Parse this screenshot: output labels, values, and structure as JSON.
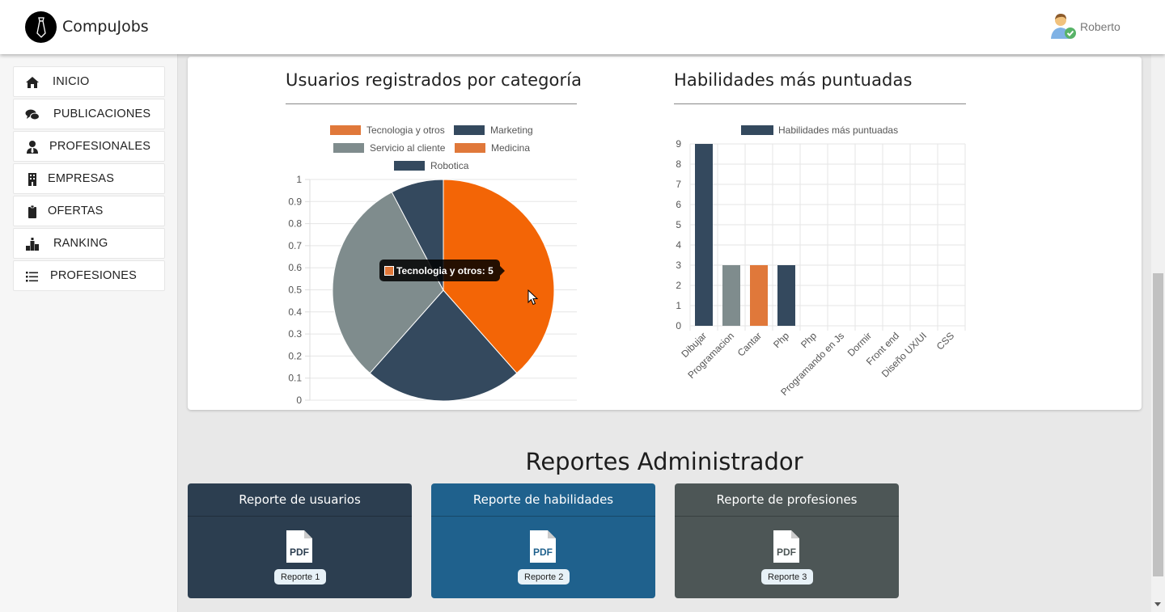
{
  "app": {
    "name": "CompuJobs",
    "user": "Roberto"
  },
  "sidebar": {
    "items": [
      {
        "label": "INICIO",
        "icon": "home-icon"
      },
      {
        "label": "PUBLICACIONES",
        "icon": "comments-icon"
      },
      {
        "label": "PROFESIONALES",
        "icon": "user-tie-icon"
      },
      {
        "label": "EMPRESAS",
        "icon": "building-icon"
      },
      {
        "label": "OFERTAS",
        "icon": "clipboard-icon"
      },
      {
        "label": "RANKING",
        "icon": "ranking-icon"
      },
      {
        "label": "PROFESIONES",
        "icon": "list-icon"
      }
    ]
  },
  "chart_data": [
    {
      "type": "pie",
      "title": "Usuarios registrados por categoría",
      "legend_placement": "top",
      "grid": true,
      "ylim": [
        0,
        1
      ],
      "yticks": [
        "0",
        "0.1",
        "0.2",
        "0.3",
        "0.4",
        "0.5",
        "0.6",
        "0.7",
        "0.8",
        "0.9",
        "1"
      ],
      "slices": [
        {
          "label": "Tecnologia y otros",
          "value": 5,
          "color": "#f36506"
        },
        {
          "label": "Marketing",
          "value": 3,
          "color": "#34495e"
        },
        {
          "label": "Servicio al cliente",
          "value": 4,
          "color": "#7f8c8d"
        },
        {
          "label": "Medicina",
          "value": 0,
          "color": "#e0783a"
        },
        {
          "label": "Robotica",
          "value": 1,
          "color": "#34495e"
        }
      ],
      "legend_colors": [
        "#e0783a",
        "#34495e",
        "#7f8c8d",
        "#e0783a",
        "#34495e"
      ],
      "tooltip": "Tecnologia y otros: 5"
    },
    {
      "type": "bar",
      "title": "Habilidades más puntuadas",
      "legend_placement": "top",
      "grid": true,
      "series": [
        {
          "name": "Habilidades más puntuadas",
          "values": [
            9,
            3,
            3,
            3,
            0,
            0,
            0,
            0,
            0,
            0
          ]
        }
      ],
      "categories": [
        "Dibujar",
        "Programacion",
        "Cantar",
        "Php",
        "Php",
        "Programando en Js",
        "Dormir",
        "Front end",
        "Diseño UX/UI",
        "CSS"
      ],
      "bar_colors": [
        "#34495e",
        "#7f8c8d",
        "#e0783a",
        "#34495e",
        "#34495e",
        "#34495e",
        "#34495e",
        "#34495e",
        "#34495e",
        "#34495e"
      ],
      "ylim": [
        0,
        9
      ],
      "yticks": [
        "0",
        "1",
        "2",
        "3",
        "4",
        "5",
        "6",
        "7",
        "8",
        "9"
      ]
    }
  ],
  "reports": {
    "title": "Reportes Administrador",
    "items": [
      {
        "heading": "Reporte de usuarios",
        "button": "Reporte 1",
        "color": "#2c3e50"
      },
      {
        "heading": "Reporte de habilidades",
        "button": "Reporte 2",
        "color": "#1f618d"
      },
      {
        "heading": "Reporte de profesiones",
        "button": "Reporte 3",
        "color": "#4d5656"
      }
    ]
  }
}
